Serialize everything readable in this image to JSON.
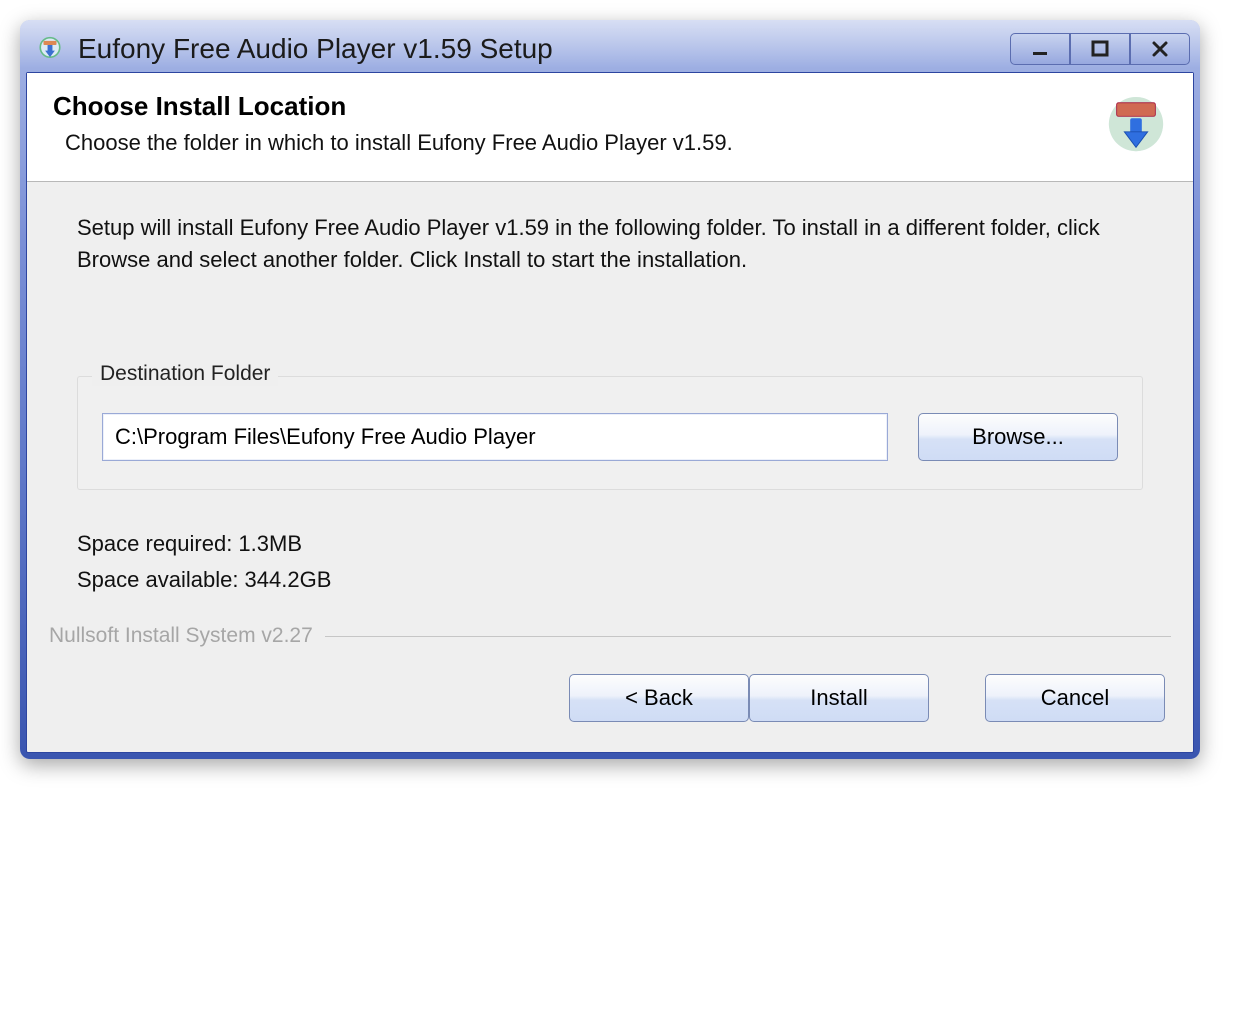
{
  "window": {
    "title": "Eufony Free Audio Player v1.59 Setup"
  },
  "header": {
    "heading": "Choose Install Location",
    "subheading": "Choose the folder in which to install Eufony Free Audio Player v1.59."
  },
  "body": {
    "description": "Setup will install Eufony Free Audio Player v1.59 in the following folder. To install in a different folder, click Browse and select another folder. Click Install to start the installation.",
    "fieldset_legend": "Destination Folder",
    "path_value": "C:\\Program Files\\Eufony Free Audio Player",
    "browse_label": "Browse...",
    "space_required": "Space required: 1.3MB",
    "space_available": "Space available: 344.2GB"
  },
  "footer": {
    "nsis_text": "Nullsoft Install System v2.27",
    "back_label": "< Back",
    "install_label": "Install",
    "cancel_label": "Cancel"
  }
}
